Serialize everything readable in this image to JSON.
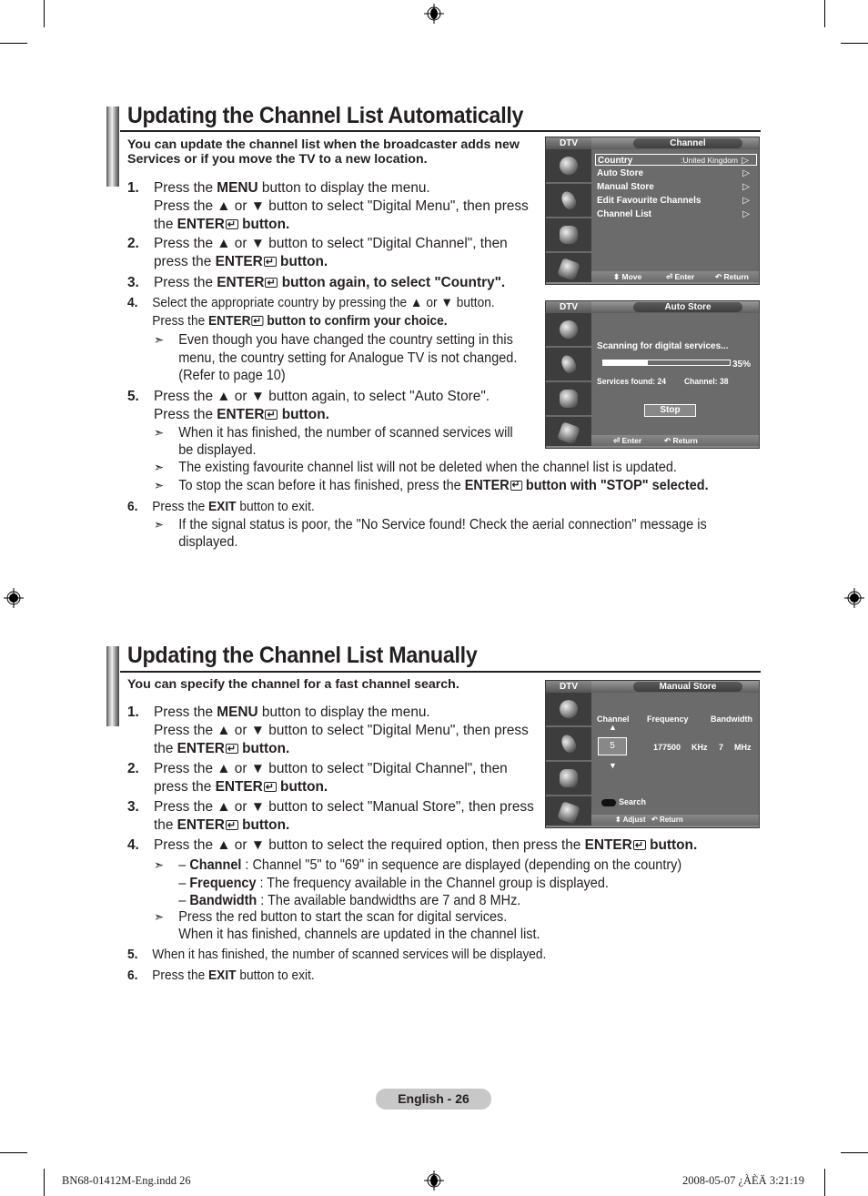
{
  "section_auto": {
    "title": "Updating the Channel List Automatically",
    "intro_line1": "You can update the channel list when the broadcaster adds new",
    "intro_line2": "Services or if you move the TV to a new location.",
    "steps": [
      {
        "num": "1.",
        "lines": [
          "Press the |MENU| button to display the menu.",
          "Press the ▲ or ▼ button to select \"Digital Menu\", then press",
          "the |ENTER|⏎| button."
        ]
      },
      {
        "num": "2.",
        "lines": [
          "Press the ▲ or ▼ button to select \"Digital Channel\", then",
          "press the |ENTER|⏎| button."
        ]
      },
      {
        "num": "3.",
        "lines": [
          "Press the |ENTER|⏎| button again, to select \"Country\"."
        ]
      },
      {
        "num": "4.",
        "lines": [
          "Select the appropriate country by pressing the ▲ or ▼ button.",
          "Press the |ENTER|⏎| button to confirm your choice."
        ]
      },
      {
        "num": "5.",
        "lines": [
          "Press the ▲ or ▼ button again, to select \"Auto Store\".",
          "Press the |ENTER|⏎| button."
        ]
      },
      {
        "num": "6.",
        "lines": [
          "Press the |EXIT| button to exit."
        ]
      }
    ],
    "notes": {
      "step4": [
        "Even though you have changed the country setting in this",
        "menu, the country setting for Analogue TV is not changed.",
        "(Refer to page 10)"
      ],
      "step5a": [
        "When it has finished, the number of scanned services will",
        "be displayed."
      ],
      "step5b": [
        "The existing favourite channel list will not be deleted when the channel list is updated."
      ],
      "step5c": [
        "To stop the scan before it has finished, press the |ENTER|⏎| button with \"STOP\" selected."
      ],
      "step6": [
        "If the signal status is poor, the \"No Service found! Check the aerial connection\" message is",
        "displayed."
      ]
    }
  },
  "section_manual": {
    "title": "Updating the Channel List Manually",
    "intro": "You can specify the channel for a fast channel search.",
    "steps": [
      {
        "num": "1.",
        "lines": [
          "Press the |MENU| button to display the menu.",
          "Press the ▲ or ▼ button to select \"Digital Menu\", then press",
          "the |ENTER|⏎| button."
        ]
      },
      {
        "num": "2.",
        "lines": [
          "Press the ▲ or ▼ button to select \"Digital Channel\", then",
          "press the |ENTER|⏎| button."
        ]
      },
      {
        "num": "3.",
        "lines": [
          "Press the ▲ or ▼ button to select \"Manual Store\", then press",
          "the |ENTER|⏎| button."
        ]
      },
      {
        "num": "4.",
        "lines": [
          "Press the ▲ or ▼ button to select  the required option,  then press the |ENTER|⏎| button."
        ]
      },
      {
        "num": "5.",
        "lines": [
          "When it has finished, the number of scanned services will be displayed."
        ]
      },
      {
        "num": "6.",
        "lines": [
          "Press the |EXIT| button to exit."
        ]
      }
    ],
    "notes": {
      "options": [
        "– |Channel| : Channel \"5\" to \"69\" in sequence are displayed (depending on the country)",
        "– |Frequency| : The frequency available in the Channel group is displayed.",
        "– |Bandwidth| : The available bandwidths are 7 and 8 MHz."
      ],
      "red": [
        "Press the red button to start the scan for digital services.",
        "When it has finished, channels are updated in the channel list."
      ]
    }
  },
  "osd_channel": {
    "tag": "DTV",
    "title": "Channel",
    "items": [
      {
        "label": "Country",
        "value": ":United Kingdom",
        "selected": true
      },
      {
        "label": "Auto Store",
        "value": "",
        "selected": false
      },
      {
        "label": "Manual Store",
        "value": "",
        "selected": false
      },
      {
        "label": "Edit Favourite Channels",
        "value": "",
        "selected": false
      },
      {
        "label": "Channel List",
        "value": "",
        "selected": false
      }
    ],
    "footer": {
      "move": "Move",
      "enter": "Enter",
      "return": "Return"
    }
  },
  "osd_auto": {
    "tag": "DTV",
    "title": "Auto Store",
    "scanning": "Scanning for digital services...",
    "progress_percent": 35,
    "progress_label": "35%",
    "services_found": "Services found: 24",
    "channel": "Channel: 38",
    "stop_label": "Stop",
    "footer": {
      "enter": "Enter",
      "return": "Return"
    }
  },
  "osd_manual": {
    "tag": "DTV",
    "title": "Manual Store",
    "col_channel": "Channel",
    "col_frequency": "Frequency",
    "col_bandwidth": "Bandwidth",
    "channel_value": "5",
    "frequency_value": "177500",
    "frequency_unit": "KHz",
    "bandwidth_value": "7",
    "bandwidth_unit": "MHz",
    "search_label": "Search",
    "footer": {
      "adjust": "Adjust",
      "return": "Return"
    }
  },
  "footer": {
    "page_label": "English - 26",
    "slug_left": "BN68-01412M-Eng.indd   26",
    "slug_right": "2008-05-07   ¿ÀÈÄ 3:21:19"
  }
}
